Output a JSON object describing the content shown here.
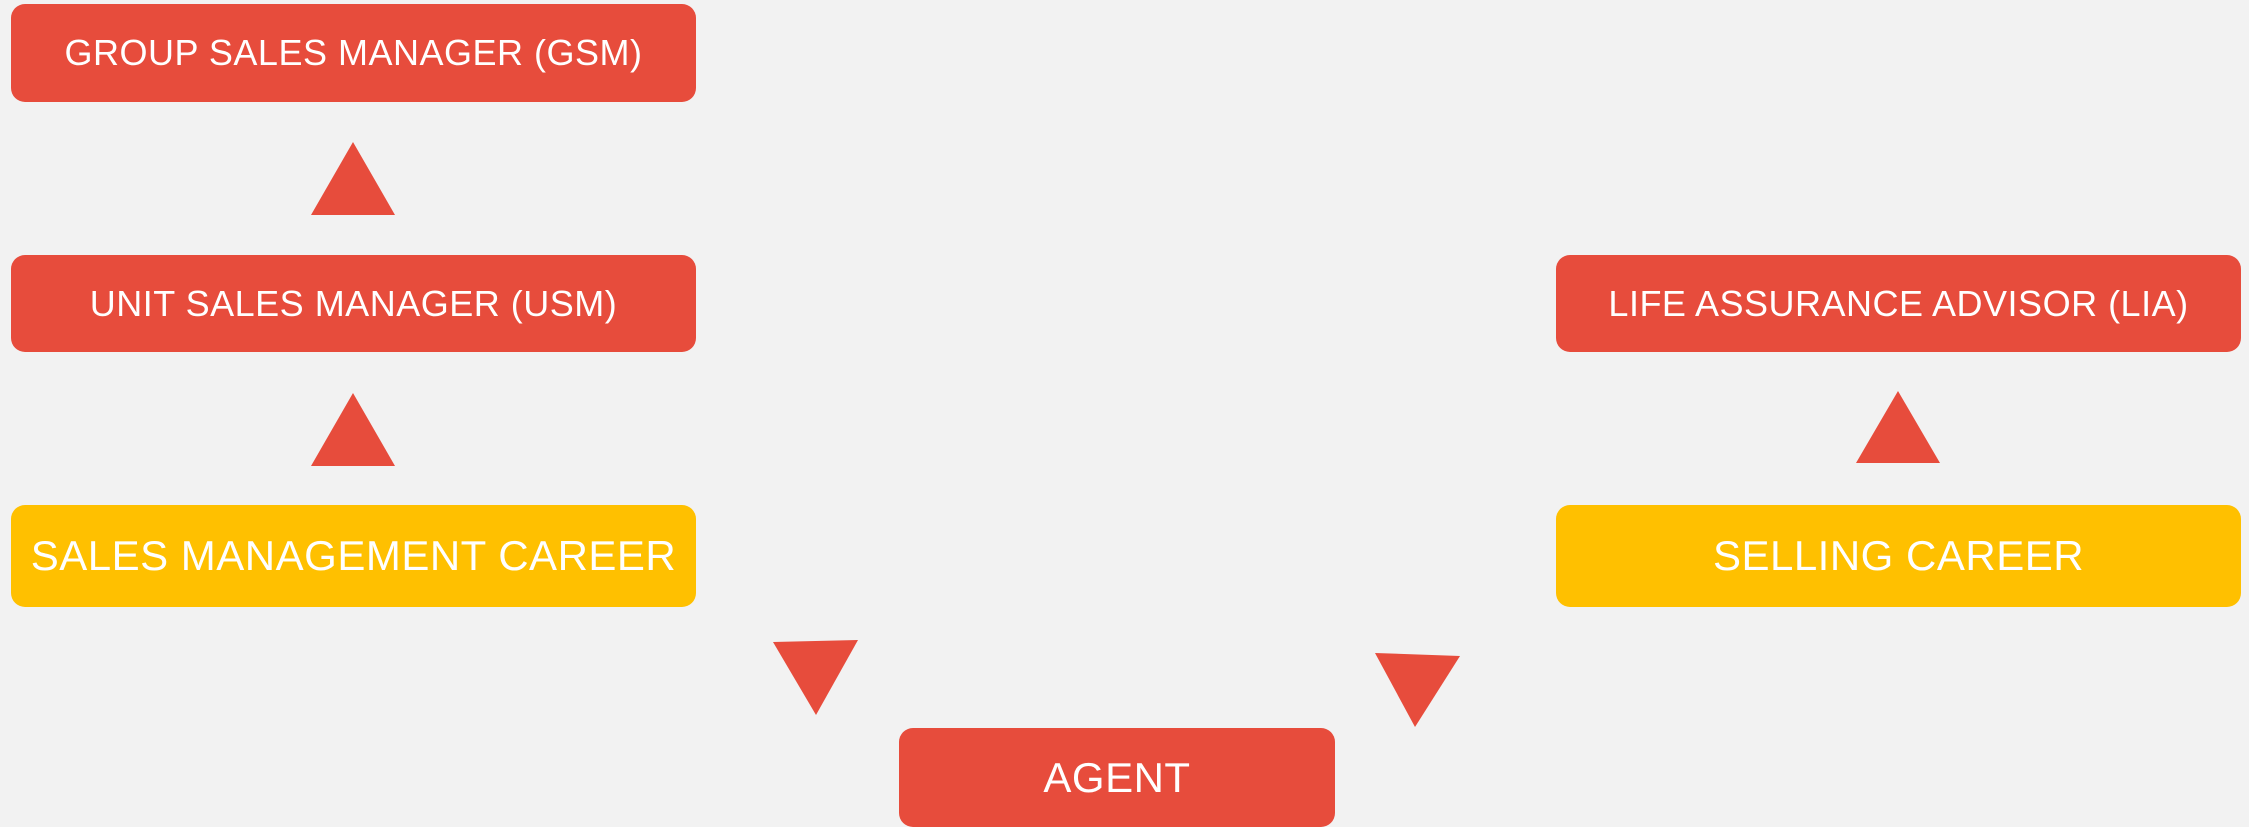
{
  "colors": {
    "role_box": "#e74c3c",
    "career_box": "#ffc000",
    "arrow": "#e74c3c",
    "background": "#f2f2f2",
    "text": "#ffffff"
  },
  "nodes": {
    "gsm": "GROUP SALES MANAGER (GSM)",
    "usm": "UNIT SALES MANAGER (USM)",
    "sales_management_career": "SALES MANAGEMENT CAREER",
    "lia": "LIFE ASSURANCE ADVISOR (LIA)",
    "selling_career": "SELLING CAREER",
    "agent": "AGENT"
  },
  "arrows": [
    "up-arrow-icon",
    "up-arrow-icon",
    "up-arrow-icon",
    "down-arrow-icon",
    "down-arrow-icon"
  ]
}
